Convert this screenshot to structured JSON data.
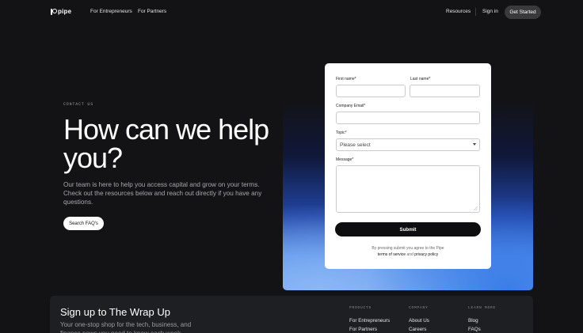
{
  "nav": {
    "logo": "pipe",
    "links": [
      "For Entrepreneurs",
      "For Partners"
    ],
    "resources": "Resources",
    "signin": "Sign in",
    "cta": "Get Started"
  },
  "hero": {
    "eyebrow": "CONTACT US",
    "title": "How can we help you?",
    "subtitle": "Our team is here to help you access capital and grow on your terms. Check out the resources below and reach out directly if you have any questions.",
    "faq_button": "Search FAQ's"
  },
  "form": {
    "first_name_label": "First name*",
    "last_name_label": "Last name*",
    "email_label": "Company Email*",
    "topic_label": "Topic*",
    "topic_value": "Please select",
    "message_label": "Message*",
    "submit_label": "Submit",
    "legal_prefix": "By pressing submit you agree to the Pipe",
    "terms": "terms of service",
    "and": "and",
    "privacy": "privacy policy"
  },
  "footer": {
    "title": "Sign up to The Wrap Up",
    "subtitle": "Your one-stop shop for the tech, business, and finance news you need to know each week.",
    "columns": [
      {
        "heading": "PRODUCTS",
        "links": [
          "For Entrepreneurs",
          "For Partners"
        ]
      },
      {
        "heading": "COMPANY",
        "links": [
          "About Us",
          "Careers"
        ]
      },
      {
        "heading": "LEARN MORE",
        "links": [
          "Blog",
          "FAQs"
        ]
      }
    ]
  },
  "colors": {
    "background": "#131315",
    "card_gradient_blue": "#3a7de8",
    "form_background": "#ffffff",
    "submit_button": "#0e0e10",
    "footer_panel": "#1e1f22"
  }
}
